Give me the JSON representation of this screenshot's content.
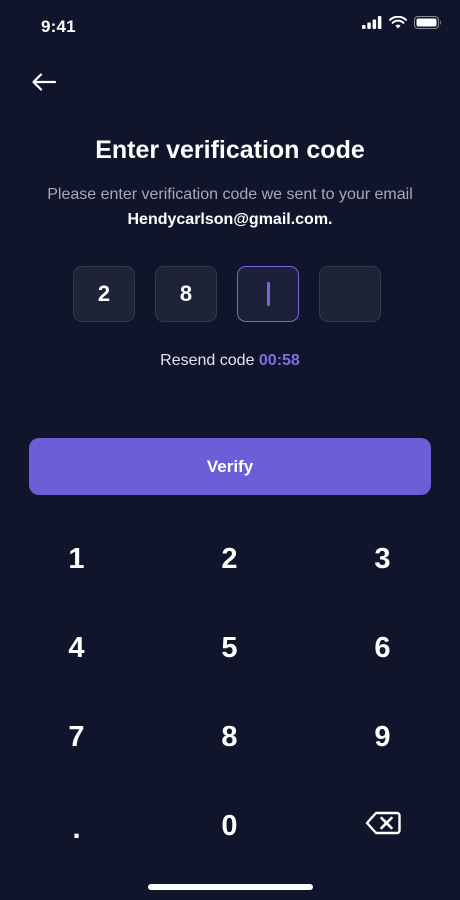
{
  "status_bar": {
    "time": "9:41"
  },
  "screen": {
    "title": "Enter verification code",
    "subtitle_prefix": "Please enter verification code we sent to your email ",
    "email": "Hendycarlson@gmail.com."
  },
  "otp": {
    "digits": [
      "2",
      "8",
      "",
      ""
    ],
    "active_index": 2
  },
  "resend": {
    "label": "Resend code ",
    "timer": "00:58"
  },
  "verify_button": {
    "label": "Verify"
  },
  "keypad": {
    "keys": [
      "1",
      "2",
      "3",
      "4",
      "5",
      "6",
      "7",
      "8",
      "9",
      ".",
      "0",
      "backspace"
    ]
  },
  "colors": {
    "background": "#11152b",
    "accent": "#6c5ed6",
    "timer": "#7d6fe4"
  }
}
